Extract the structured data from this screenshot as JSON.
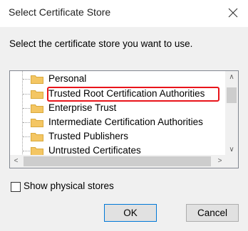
{
  "window": {
    "title": "Select Certificate Store",
    "close_icon": "close-icon"
  },
  "instruction": "Select the certificate store you want to use.",
  "tree": {
    "items": [
      {
        "label": "Personal",
        "icon": "folder-icon"
      },
      {
        "label": "Trusted Root Certification Authorities",
        "icon": "folder-icon",
        "highlighted": true
      },
      {
        "label": "Enterprise Trust",
        "icon": "folder-icon"
      },
      {
        "label": "Intermediate Certification Authorities",
        "icon": "folder-icon"
      },
      {
        "label": "Trusted Publishers",
        "icon": "folder-icon"
      },
      {
        "label": "Untrusted Certificates",
        "icon": "folder-icon"
      }
    ],
    "highlight_color": "#e8141a"
  },
  "scroll": {
    "up_glyph": "∧",
    "down_glyph": "∨",
    "left_glyph": "<",
    "right_glyph": ">"
  },
  "checkbox": {
    "label": "Show physical stores",
    "checked": false
  },
  "buttons": {
    "ok": "OK",
    "cancel": "Cancel"
  },
  "colors": {
    "folder": "#f4c663",
    "folder_dark": "#d9a93c",
    "accent_border": "#0078d7"
  }
}
